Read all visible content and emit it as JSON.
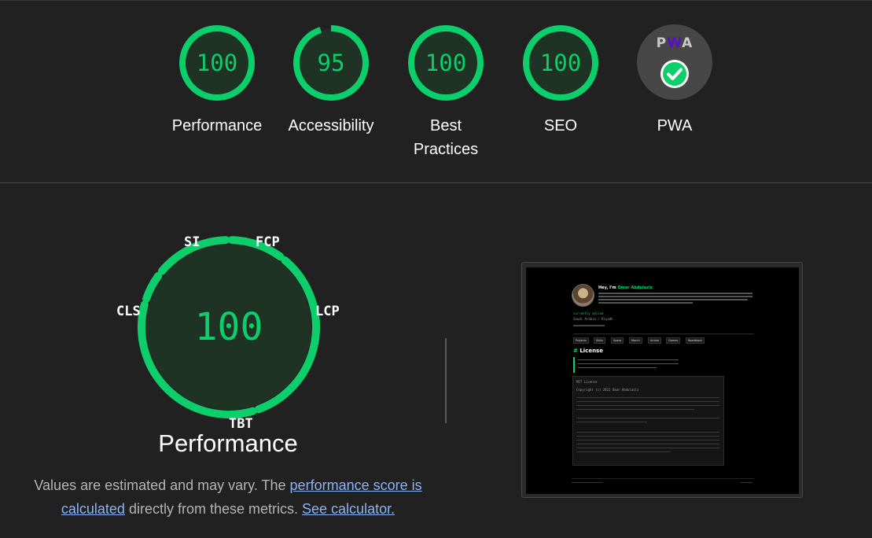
{
  "scores": [
    {
      "label": "Performance",
      "value": "100",
      "fraction": 1.0
    },
    {
      "label": "Accessibility",
      "value": "95",
      "fraction": 0.95
    },
    {
      "label": "Best Practices",
      "value": "100",
      "fraction": 1.0
    },
    {
      "label": "SEO",
      "value": "100",
      "fraction": 1.0
    }
  ],
  "pwa": {
    "label": "PWA",
    "logo_p": "P",
    "logo_w": "W",
    "logo_a": "A",
    "icon": "check-circle-icon"
  },
  "performance": {
    "score": "100",
    "title": "Performance",
    "metrics": {
      "si": "SI",
      "fcp": "FCP",
      "lcp": "LCP",
      "tbt": "TBT",
      "cls": "CLS"
    },
    "note_before": "Values are estimated and may vary. The ",
    "note_link": "performance score is calculated",
    "note_middle": " directly from these metrics. ",
    "note_calc_link": "See calculator."
  },
  "thumbnail": {
    "greeting_prefix": "Hey, I'm ",
    "greeting_name": "Omar Abdulaziz",
    "license_hash": "#",
    "license_title": "License",
    "tags": [
      "Projects",
      "Skills",
      "Specs",
      "Merch",
      "Anime",
      "Games",
      "Roadblock"
    ],
    "status_1": "currently online",
    "status_2": "Saudi Arabia / Riyadh",
    "box_line_1": "MIT License",
    "box_line_2": "Copyright (c) 2022 Omar Abdulaziz"
  },
  "colors": {
    "pass": "#0cce6b",
    "pass_bg": "#1e3324",
    "background": "#212121",
    "link": "#8ab4f8"
  }
}
